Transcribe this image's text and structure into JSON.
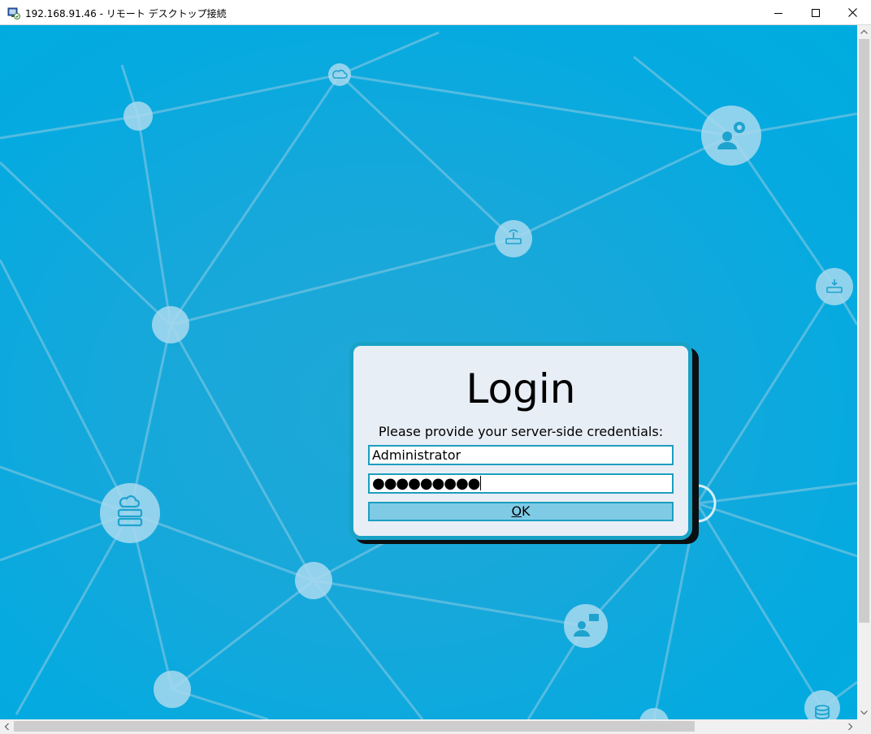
{
  "window": {
    "title": "192.168.91.46 - リモート デスクトップ接続",
    "icon": "remote-desktop-icon",
    "controls": [
      "minimize-icon",
      "maximize-icon",
      "close-icon"
    ]
  },
  "login": {
    "title": "Login",
    "prompt": "Please provide your server-side credentials:",
    "username_value": "Administrator",
    "password_mask": "●●●●●●●●●",
    "ok_accesskey": "O",
    "ok_rest": "K"
  },
  "background": {
    "node_icons": [
      "cloud-icon",
      "user-gear-icon",
      "router-icon",
      "download-server-icon",
      "cloud-server-icon",
      "user-mail-icon",
      "database-icon"
    ]
  },
  "colors": {
    "desktop": "#04aae0",
    "dialog_border": "#19a2c6",
    "dialog_bg": "#e8eef6",
    "ok_button": "#7fcbe6"
  }
}
